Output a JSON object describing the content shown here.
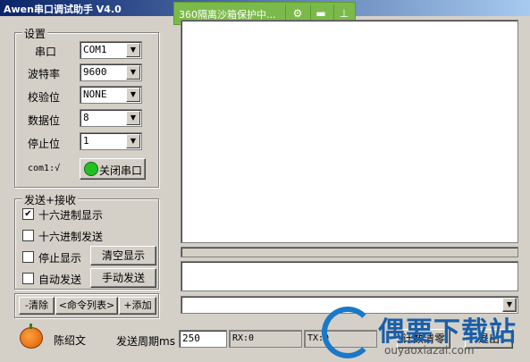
{
  "window": {
    "title": "Awen串口调试助手 V4.0"
  },
  "sandbox_bar": {
    "text": "360隔离沙箱保护中...",
    "icons": [
      "sandbox-manage-icon",
      "folder-icon",
      "pin-icon"
    ]
  },
  "settings": {
    "group_title": "设置",
    "fields": [
      {
        "label": "串口",
        "value": "COM1"
      },
      {
        "label": "波特率",
        "value": "9600"
      },
      {
        "label": "校验位",
        "value": "NONE"
      },
      {
        "label": "数据位",
        "value": "8"
      },
      {
        "label": "停止位",
        "value": "1"
      }
    ],
    "port_status": "com1:√",
    "toggle_button": "关闭串口",
    "status_light_color": "#22c022"
  },
  "sendrecv": {
    "group_title": "发送+接收",
    "hex_display": {
      "label": "十六进制显示",
      "checked": true
    },
    "hex_send": {
      "label": "十六进制发送",
      "checked": false
    },
    "stop_display": {
      "label": "停止显示",
      "checked": false
    },
    "auto_send": {
      "label": "自动发送",
      "checked": false
    },
    "clear_display_button": "清空显示",
    "manual_send_button": "手动发送"
  },
  "cmdlist": {
    "clear_button": "-清除",
    "list_button": "<命令列表>",
    "add_button": "+添加"
  },
  "bottom": {
    "author": "陈绍文",
    "send_period_label": "发送周期ms",
    "send_period_value": "250",
    "rx": "RX:0",
    "tx": "TX:0",
    "reset_count_button": "计数清零",
    "exit_button": "退出"
  },
  "watermark": {
    "title": "偶要下载站",
    "url": "ouyaoxiazai.com"
  }
}
